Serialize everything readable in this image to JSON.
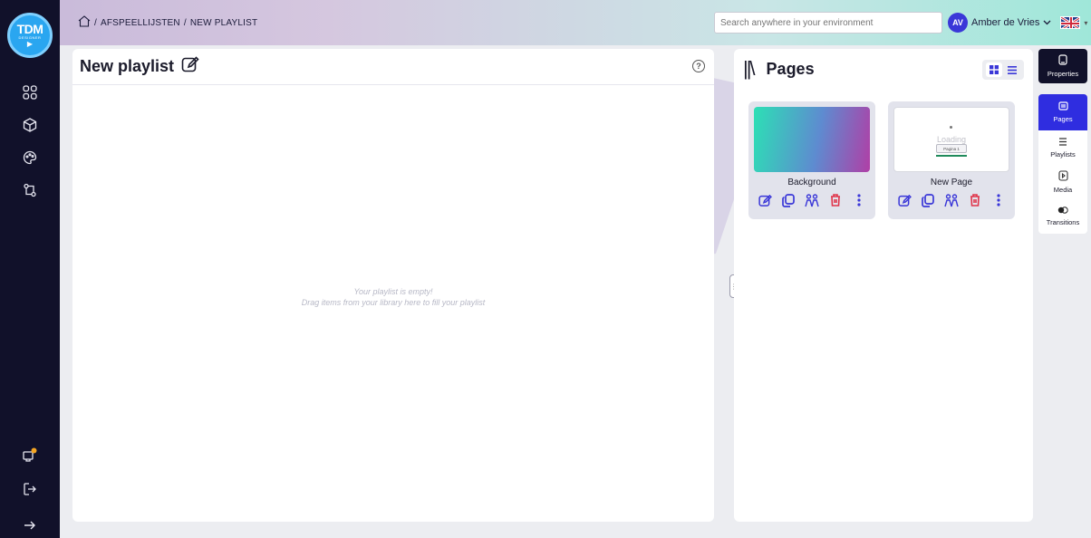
{
  "logo": {
    "line1": "TDM",
    "line2": "DESIGNER"
  },
  "breadcrumb": {
    "separator": "/",
    "level1": "AFSPEELLIJSTEN",
    "level2": "NEW PLAYLIST"
  },
  "search": {
    "placeholder": "Search anywhere in your environment"
  },
  "user": {
    "initials": "AV",
    "name": "Amber de Vries"
  },
  "playlist": {
    "title": "New playlist",
    "help": "?",
    "empty_line1": "Your playlist is empty!",
    "empty_line2": "Drag items from your library here to fill your playlist"
  },
  "pages": {
    "title": "Pages",
    "cards": [
      {
        "label": "Background"
      },
      {
        "label": "New Page",
        "thumb_text": "Loading",
        "thumb_button": "Pagina 1"
      }
    ]
  },
  "tabs": {
    "properties": "Properties",
    "pages": "Pages",
    "playlists": "Playlists",
    "media": "Media",
    "transitions": "Transitions"
  },
  "colors": {
    "sidebar": "#11112a",
    "accent": "#2f2de0",
    "delete": "#e0344a",
    "action": "#3a37d8"
  }
}
